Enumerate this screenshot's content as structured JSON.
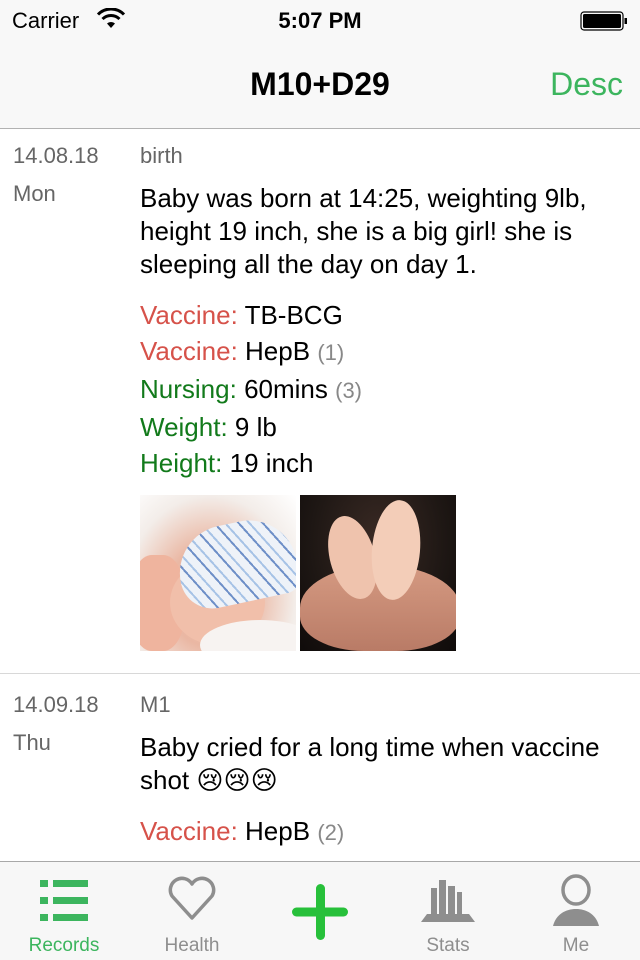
{
  "status_bar": {
    "carrier": "Carrier",
    "time": "5:07 PM",
    "wifi_icon": "wifi-icon",
    "battery_icon": "battery-full-icon"
  },
  "nav_bar": {
    "title": "M10+D29",
    "right_button": "Desc"
  },
  "colors": {
    "accent_green": "#3cb55e",
    "label_red": "#d6524a",
    "label_green": "#127a1b",
    "count_gray": "#888888"
  },
  "records": [
    {
      "date": "14.08.18",
      "day": "Mon",
      "tag": "birth",
      "text": "Baby was born at 14:25, weighting 9lb, height 19 inch, she is a big girl! she is sleeping all the day on day 1.",
      "details": [
        {
          "label": "Vaccine:",
          "value": "TB-BCG",
          "count": "",
          "kind": "red"
        },
        {
          "label": "Vaccine:",
          "value": "HepB",
          "count": "(1)",
          "kind": "red"
        },
        {
          "label": "Nursing:",
          "value": "60mins",
          "count": "(3)",
          "kind": "green"
        },
        {
          "label": "Weight:",
          "value": "9 lb",
          "count": "",
          "kind": "green"
        },
        {
          "label": "Height:",
          "value": "19 inch",
          "count": "",
          "kind": "green"
        }
      ],
      "photos": [
        "sleeping-baby-photo",
        "baby-feet-photo"
      ]
    },
    {
      "date": "14.09.18",
      "day": "Thu",
      "tag": "M1",
      "text": "Baby cried for a long time when vaccine shot 😢😢😢",
      "details": [
        {
          "label": "Vaccine:",
          "value": "HepB",
          "count": "(2)",
          "kind": "red"
        }
      ],
      "photos": [
        "baby-photo",
        "text-image-photo"
      ]
    }
  ],
  "tab_bar": {
    "items": [
      {
        "label": "Records",
        "icon": "list-icon",
        "active": true
      },
      {
        "label": "Health",
        "icon": "heart-icon",
        "active": false
      },
      {
        "label": "",
        "icon": "plus-icon",
        "active": false
      },
      {
        "label": "Stats",
        "icon": "bar-chart-icon",
        "active": false
      },
      {
        "label": "Me",
        "icon": "person-icon",
        "active": false
      }
    ]
  }
}
